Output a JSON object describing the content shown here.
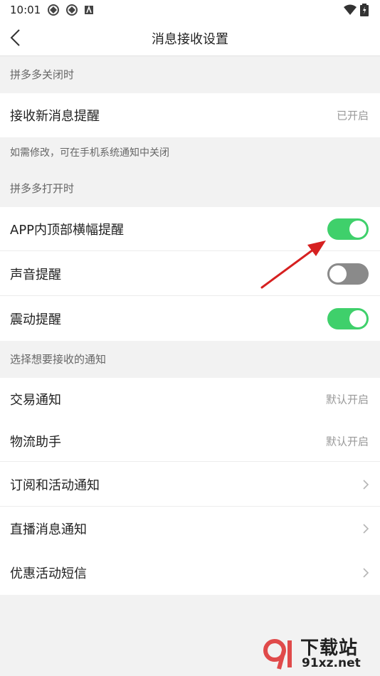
{
  "status_bar": {
    "time": "10:01"
  },
  "header": {
    "title": "消息接收设置"
  },
  "sections": {
    "closed": {
      "title": "拼多多关闭时",
      "row": {
        "label": "接收新消息提醒",
        "value": "已开启"
      },
      "note": "如需修改，可在手机系统通知中关闭"
    },
    "open": {
      "title": "拼多多打开时",
      "rows": [
        {
          "label": "APP内顶部横幅提醒",
          "on": true
        },
        {
          "label": "声音提醒",
          "on": false
        },
        {
          "label": "震动提醒",
          "on": true
        }
      ]
    },
    "choose": {
      "title": "选择想要接收的通知",
      "rows": [
        {
          "label": "交易通知",
          "value": "默认开启"
        },
        {
          "label": "物流助手",
          "value": "默认开启"
        },
        {
          "label": "订阅和活动通知"
        },
        {
          "label": "直播消息通知"
        },
        {
          "label": "优惠活动短信"
        }
      ]
    }
  },
  "colors": {
    "toggle_on": "#3fd06b",
    "toggle_off": "#8a8a8a",
    "arrow": "#d62020"
  },
  "watermark": {
    "text_cn": "下载站",
    "text_url": "91xz.net"
  }
}
